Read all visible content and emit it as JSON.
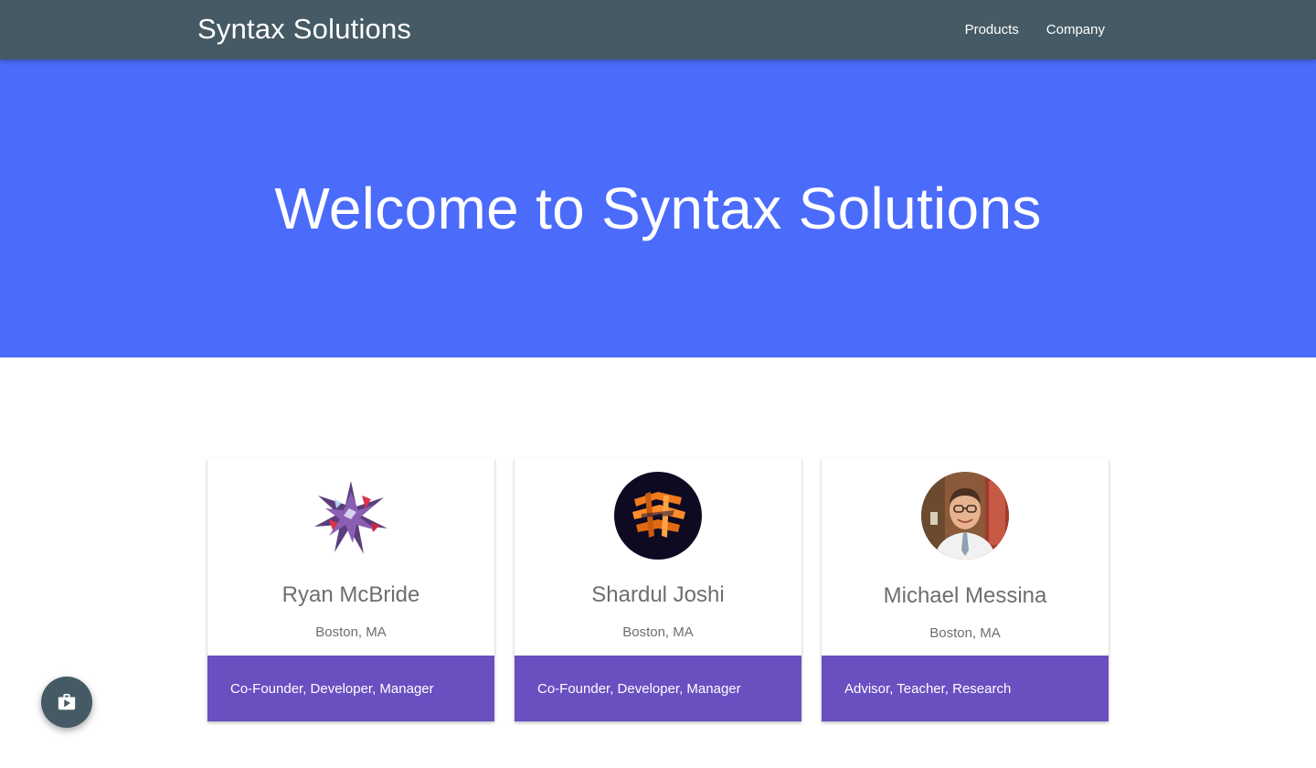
{
  "navbar": {
    "brand": "Syntax Solutions",
    "links": [
      {
        "label": "Products"
      },
      {
        "label": "Company"
      }
    ]
  },
  "hero": {
    "title": "Welcome to Syntax Solutions"
  },
  "cards": [
    {
      "name": "Ryan McBride",
      "location": "Boston, MA",
      "roles": "Co-Founder, Developer, Manager",
      "avatar": "abstract-star-avatar"
    },
    {
      "name": "Shardul Joshi",
      "location": "Boston, MA",
      "roles": "Co-Founder, Developer, Manager",
      "avatar": "orange-blocks-avatar"
    },
    {
      "name": "Michael Messina",
      "location": "Boston, MA",
      "roles": "Advisor, Teacher, Research",
      "avatar": "person-photo-avatar"
    }
  ],
  "fab": {
    "icon": "shop-icon"
  },
  "colors": {
    "navbar": "#455a64",
    "hero": "#4b6bfb",
    "card_action": "#6a4fc1"
  }
}
